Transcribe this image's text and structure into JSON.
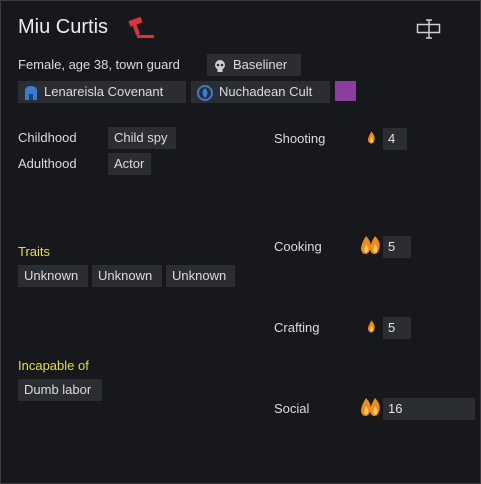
{
  "pawn": {
    "name": "Miu Curtis",
    "subtitle": "Female, age 38, town guard",
    "xenotype": "Baseliner",
    "faction": "Lenareisla Covenant",
    "ideology": "Nuchadean Cult",
    "ideology_color": "#8a3fa0"
  },
  "backstory": {
    "childhood_label": "Childhood",
    "childhood_value": "Child spy",
    "adulthood_label": "Adulthood",
    "adulthood_value": "Actor"
  },
  "traits": {
    "label": "Traits",
    "items": [
      "Unknown",
      "Unknown",
      "Unknown"
    ]
  },
  "incapable": {
    "label": "Incapable of",
    "items": [
      "Dumb labor"
    ]
  },
  "skills": [
    {
      "name": "Shooting",
      "level": "4",
      "passion": "minor"
    },
    {
      "name": "Cooking",
      "level": "5",
      "passion": "major"
    },
    {
      "name": "Crafting",
      "level": "5",
      "passion": "minor"
    },
    {
      "name": "Social",
      "level": "16",
      "passion": "major"
    }
  ],
  "colors": {
    "background": "#16181b",
    "chip": "#2a2d31",
    "accent_yellow": "#e6dc4a",
    "gavel_red": "#d93535",
    "faction_blue": "#3a7bd5"
  }
}
